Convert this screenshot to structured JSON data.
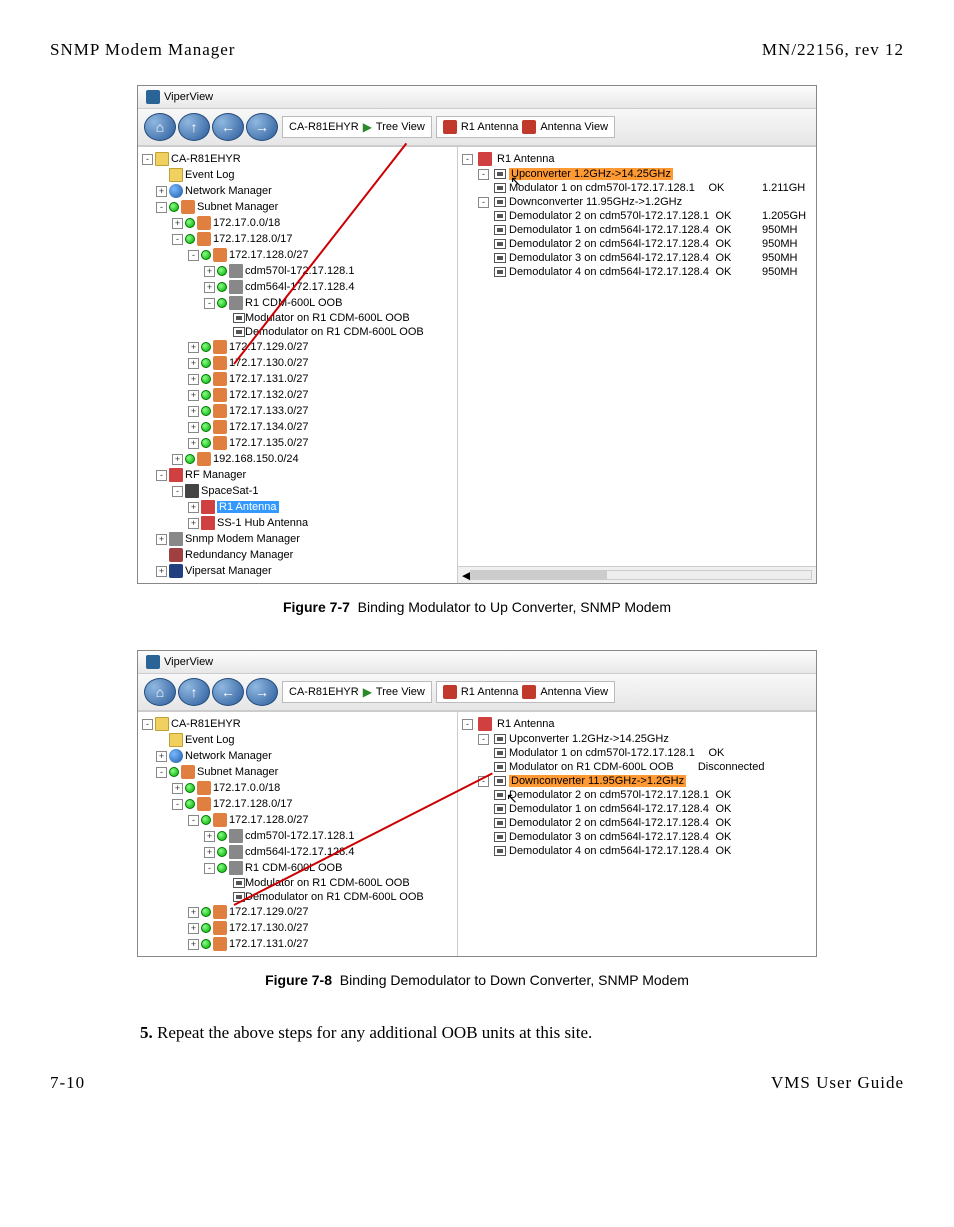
{
  "header": {
    "left": "SNMP Modem Manager",
    "right": "MN/22156, rev 12"
  },
  "viperview": {
    "title": "ViperView",
    "breadcrumb1": "CA-R81EHYR",
    "breadcrumbView1": "Tree View",
    "breadcrumb2": "R1 Antenna",
    "breadcrumbView2": "Antenna View"
  },
  "fig77": {
    "caption_label": "Figure 7-7",
    "caption_text": "Binding Modulator to Up Converter, SNMP Modem",
    "left_tree": [
      {
        "indent": 0,
        "toggle": "-",
        "icons": [
          "ic-folder"
        ],
        "label": "CA-R81EHYR"
      },
      {
        "indent": 1,
        "toggle": "",
        "icons": [
          "ic-folder"
        ],
        "label": "Event Log"
      },
      {
        "indent": 1,
        "toggle": "+",
        "icons": [
          "ic-globe"
        ],
        "label": "Network Manager"
      },
      {
        "indent": 1,
        "toggle": "-",
        "icons": [
          "ic-green-dot",
          "ic-net"
        ],
        "label": "Subnet Manager"
      },
      {
        "indent": 2,
        "toggle": "+",
        "icons": [
          "ic-green-dot",
          "ic-net"
        ],
        "label": "172.17.0.0/18"
      },
      {
        "indent": 2,
        "toggle": "-",
        "icons": [
          "ic-green-dot",
          "ic-net"
        ],
        "label": "172.17.128.0/17"
      },
      {
        "indent": 3,
        "toggle": "-",
        "icons": [
          "ic-green-dot",
          "ic-net"
        ],
        "label": "172.17.128.0/27"
      },
      {
        "indent": 4,
        "toggle": "+",
        "icons": [
          "ic-green-dot",
          "ic-dev"
        ],
        "label": "cdm570l-172.17.128.1"
      },
      {
        "indent": 4,
        "toggle": "+",
        "icons": [
          "ic-green-dot",
          "ic-dev"
        ],
        "label": "cdm564l-172.17.128.4"
      },
      {
        "indent": 4,
        "toggle": "-",
        "icons": [
          "ic-green-dot",
          "ic-dev"
        ],
        "label": "R1 CDM-600L OOB"
      },
      {
        "indent": 5,
        "toggle": "",
        "icons": [
          "modem"
        ],
        "label": "Modulator on R1 CDM-600L OOB"
      },
      {
        "indent": 5,
        "toggle": "",
        "icons": [
          "modem"
        ],
        "label": "Demodulator on R1 CDM-600L OOB"
      },
      {
        "indent": 3,
        "toggle": "+",
        "icons": [
          "ic-green-dot",
          "ic-net"
        ],
        "label": "172.17.129.0/27"
      },
      {
        "indent": 3,
        "toggle": "+",
        "icons": [
          "ic-green-dot",
          "ic-net"
        ],
        "label": "172.17.130.0/27"
      },
      {
        "indent": 3,
        "toggle": "+",
        "icons": [
          "ic-green-dot",
          "ic-net"
        ],
        "label": "172.17.131.0/27"
      },
      {
        "indent": 3,
        "toggle": "+",
        "icons": [
          "ic-green-dot",
          "ic-net"
        ],
        "label": "172.17.132.0/27"
      },
      {
        "indent": 3,
        "toggle": "+",
        "icons": [
          "ic-green-dot",
          "ic-net"
        ],
        "label": "172.17.133.0/27"
      },
      {
        "indent": 3,
        "toggle": "+",
        "icons": [
          "ic-green-dot",
          "ic-net"
        ],
        "label": "172.17.134.0/27"
      },
      {
        "indent": 3,
        "toggle": "+",
        "icons": [
          "ic-green-dot",
          "ic-net"
        ],
        "label": "172.17.135.0/27"
      },
      {
        "indent": 2,
        "toggle": "+",
        "icons": [
          "ic-green-dot",
          "ic-net"
        ],
        "label": "192.168.150.0/24"
      },
      {
        "indent": 1,
        "toggle": "-",
        "icons": [
          "ic-rf"
        ],
        "label": "RF Manager"
      },
      {
        "indent": 2,
        "toggle": "-",
        "icons": [
          "ic-sat"
        ],
        "label": "SpaceSat-1"
      },
      {
        "indent": 3,
        "toggle": "+",
        "icons": [
          "ic-rf"
        ],
        "label": "R1 Antenna",
        "selected": "selected"
      },
      {
        "indent": 3,
        "toggle": "+",
        "icons": [
          "ic-rf"
        ],
        "label": "SS-1 Hub Antenna"
      },
      {
        "indent": 1,
        "toggle": "+",
        "icons": [
          "ic-dev"
        ],
        "label": "Snmp Modem Manager"
      },
      {
        "indent": 1,
        "toggle": "",
        "icons": [
          "ic-redund"
        ],
        "label": "Redundancy Manager"
      },
      {
        "indent": 1,
        "toggle": "+",
        "icons": [
          "ic-viper"
        ],
        "label": "Vipersat Manager"
      }
    ],
    "right_tree": [
      {
        "indent": 0,
        "toggle": "-",
        "label": "R1 Antenna",
        "icons": [
          "ic-rf"
        ]
      },
      {
        "indent": 1,
        "toggle": "-",
        "label": "Upconverter 1.2GHz->14.25GHz",
        "icons": [
          "modem"
        ],
        "selected": "selected-orange"
      },
      {
        "indent": 2,
        "toggle": "",
        "label": "Modulator 1 on cdm570l-172.17.128.1",
        "icons": [
          "modem"
        ],
        "status": "OK",
        "freq": "1.211GH"
      },
      {
        "indent": 1,
        "toggle": "-",
        "label": "Downconverter 11.95GHz->1.2GHz",
        "icons": [
          "modem"
        ]
      },
      {
        "indent": 2,
        "toggle": "",
        "label": "Demodulator 2 on cdm570l-172.17.128.1",
        "icons": [
          "modem"
        ],
        "status": "OK",
        "freq": "1.205GH"
      },
      {
        "indent": 2,
        "toggle": "",
        "label": "Demodulator 1 on cdm564l-172.17.128.4",
        "icons": [
          "modem"
        ],
        "status": "OK",
        "freq": "950MH"
      },
      {
        "indent": 2,
        "toggle": "",
        "label": "Demodulator 2 on cdm564l-172.17.128.4",
        "icons": [
          "modem"
        ],
        "status": "OK",
        "freq": "950MH"
      },
      {
        "indent": 2,
        "toggle": "",
        "label": "Demodulator 3 on cdm564l-172.17.128.4",
        "icons": [
          "modem"
        ],
        "status": "OK",
        "freq": "950MH"
      },
      {
        "indent": 2,
        "toggle": "",
        "label": "Demodulator 4 on cdm564l-172.17.128.4",
        "icons": [
          "modem"
        ],
        "status": "OK",
        "freq": "950MH"
      }
    ]
  },
  "fig78": {
    "caption_label": "Figure 7-8",
    "caption_text": "Binding Demodulator to Down Converter, SNMP Modem",
    "left_tree": [
      {
        "indent": 0,
        "toggle": "-",
        "icons": [
          "ic-folder"
        ],
        "label": "CA-R81EHYR"
      },
      {
        "indent": 1,
        "toggle": "",
        "icons": [
          "ic-folder"
        ],
        "label": "Event Log"
      },
      {
        "indent": 1,
        "toggle": "+",
        "icons": [
          "ic-globe"
        ],
        "label": "Network Manager"
      },
      {
        "indent": 1,
        "toggle": "-",
        "icons": [
          "ic-green-dot",
          "ic-net"
        ],
        "label": "Subnet Manager"
      },
      {
        "indent": 2,
        "toggle": "+",
        "icons": [
          "ic-green-dot",
          "ic-net"
        ],
        "label": "172.17.0.0/18"
      },
      {
        "indent": 2,
        "toggle": "-",
        "icons": [
          "ic-green-dot",
          "ic-net"
        ],
        "label": "172.17.128.0/17"
      },
      {
        "indent": 3,
        "toggle": "-",
        "icons": [
          "ic-green-dot",
          "ic-net"
        ],
        "label": "172.17.128.0/27"
      },
      {
        "indent": 4,
        "toggle": "+",
        "icons": [
          "ic-green-dot",
          "ic-dev"
        ],
        "label": "cdm570l-172.17.128.1"
      },
      {
        "indent": 4,
        "toggle": "+",
        "icons": [
          "ic-green-dot",
          "ic-dev"
        ],
        "label": "cdm564l-172.17.128.4"
      },
      {
        "indent": 4,
        "toggle": "-",
        "icons": [
          "ic-green-dot",
          "ic-dev"
        ],
        "label": "R1 CDM-600L OOB"
      },
      {
        "indent": 5,
        "toggle": "",
        "icons": [
          "modem"
        ],
        "label": "Modulator on R1 CDM-600L OOB"
      },
      {
        "indent": 5,
        "toggle": "",
        "icons": [
          "modem"
        ],
        "label": "Demodulator on R1 CDM-600L OOB"
      },
      {
        "indent": 3,
        "toggle": "+",
        "icons": [
          "ic-green-dot",
          "ic-net"
        ],
        "label": "172.17.129.0/27"
      },
      {
        "indent": 3,
        "toggle": "+",
        "icons": [
          "ic-green-dot",
          "ic-net"
        ],
        "label": "172.17.130.0/27"
      },
      {
        "indent": 3,
        "toggle": "+",
        "icons": [
          "ic-green-dot",
          "ic-net"
        ],
        "label": "172.17.131.0/27"
      }
    ],
    "right_tree": [
      {
        "indent": 0,
        "toggle": "-",
        "label": "R1 Antenna",
        "icons": [
          "ic-rf"
        ]
      },
      {
        "indent": 1,
        "toggle": "-",
        "label": "Upconverter 1.2GHz->14.25GHz",
        "icons": [
          "modem"
        ]
      },
      {
        "indent": 2,
        "toggle": "",
        "label": "Modulator 1 on cdm570l-172.17.128.1",
        "icons": [
          "modem"
        ],
        "status": "OK",
        "freq": ""
      },
      {
        "indent": 2,
        "toggle": "",
        "label": "Modulator on R1 CDM-600L OOB",
        "icons": [
          "modem"
        ],
        "status": "Disconnected",
        "freq": ""
      },
      {
        "indent": 1,
        "toggle": "-",
        "label": "Downconverter 11.95GHz->1.2GHz",
        "icons": [
          "modem"
        ],
        "selected": "selected-orange"
      },
      {
        "indent": 2,
        "toggle": "",
        "label": "Demodulator 2 on cdm570l-172.17.128.1",
        "icons": [
          "modem"
        ],
        "status": "OK",
        "freq": ""
      },
      {
        "indent": 2,
        "toggle": "",
        "label": "Demodulator 1 on cdm564l-172.17.128.4",
        "icons": [
          "modem"
        ],
        "status": "OK",
        "freq": ""
      },
      {
        "indent": 2,
        "toggle": "",
        "label": "Demodulator 2 on cdm564l-172.17.128.4",
        "icons": [
          "modem"
        ],
        "status": "OK",
        "freq": ""
      },
      {
        "indent": 2,
        "toggle": "",
        "label": "Demodulator 3 on cdm564l-172.17.128.4",
        "icons": [
          "modem"
        ],
        "status": "OK",
        "freq": ""
      },
      {
        "indent": 2,
        "toggle": "",
        "label": "Demodulator 4 on cdm564l-172.17.128.4",
        "icons": [
          "modem"
        ],
        "status": "OK",
        "freq": ""
      }
    ]
  },
  "body_step": "5.",
  "body_text": "Repeat the above steps for any additional OOB units at this site.",
  "footer": {
    "left": "7-10",
    "right": "VMS User Guide"
  }
}
